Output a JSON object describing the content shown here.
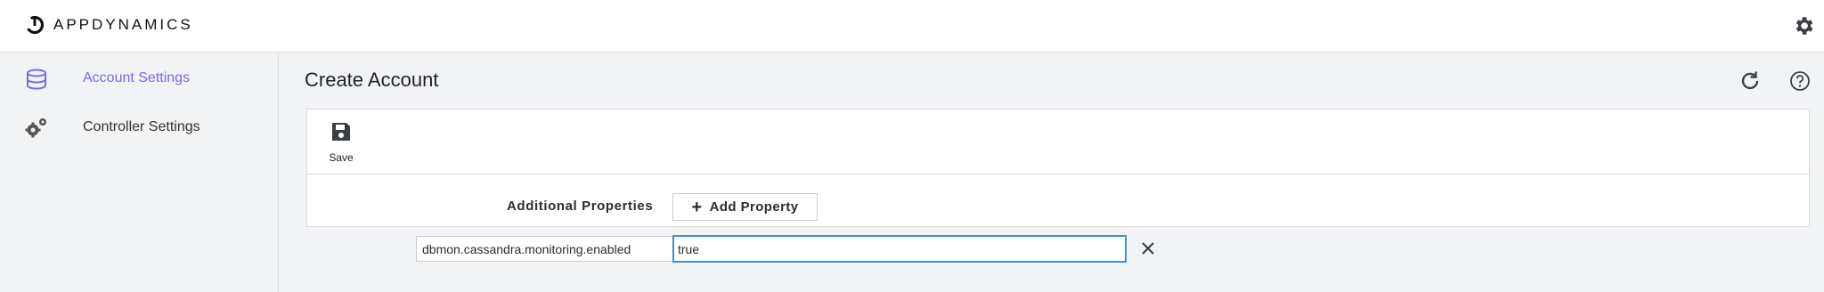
{
  "app": {
    "brand": "APPDYNAMICS"
  },
  "sidebar": {
    "items": [
      {
        "label": "Account Settings",
        "icon": "database-icon",
        "active": true
      },
      {
        "label": "Controller Settings",
        "icon": "gears-icon",
        "active": false
      }
    ]
  },
  "page": {
    "title": "Create Account"
  },
  "toolbar": {
    "save_label": "Save"
  },
  "form": {
    "additional_properties_label": "Additional Properties",
    "add_property_label": "Add Property",
    "property_key": "dbmon.cassandra.monitoring.enabled",
    "property_value": "true"
  },
  "colors": {
    "accent": "#7b68ee",
    "focus": "#3d8fd6"
  }
}
